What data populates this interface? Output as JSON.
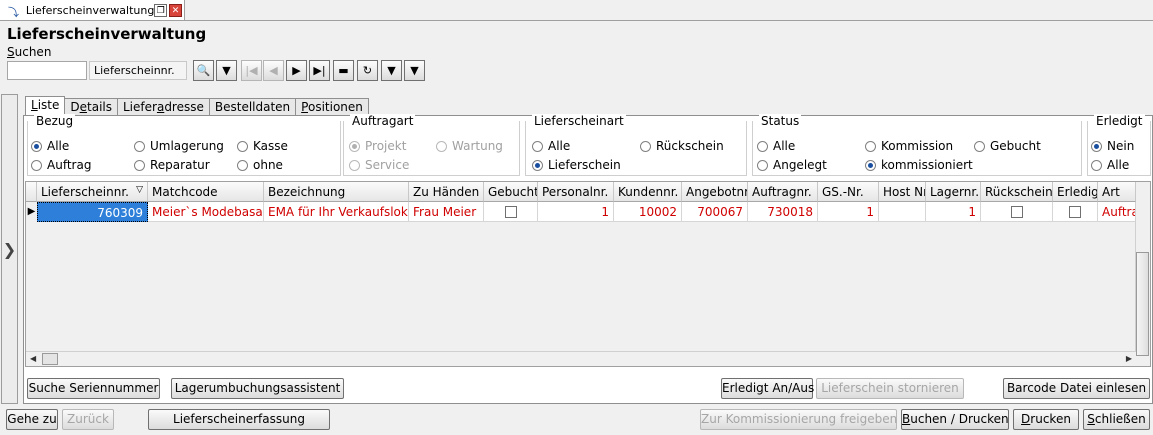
{
  "window": {
    "tab_title": "Lieferscheinverwaltung",
    "page_title": "Lieferscheinverwaltung"
  },
  "search": {
    "label": "Suchen",
    "value": "",
    "field": "Lieferscheinnr."
  },
  "tabs": [
    "Liste",
    "Details",
    "Lieferadresse",
    "Bestelldaten",
    "Positionen"
  ],
  "filters": {
    "bezug": {
      "title": "Bezug",
      "options": [
        "Alle",
        "Umlagerung",
        "Kasse",
        "Auftrag",
        "Reparatur",
        "ohne"
      ],
      "selected": "Alle"
    },
    "auftragart": {
      "title": "Auftragart",
      "options": [
        "Projekt",
        "Wartung",
        "Service"
      ],
      "selected": "Projekt"
    },
    "lieferscheinart": {
      "title": "Lieferscheinart",
      "options": [
        "Alle",
        "Rückschein",
        "Lieferschein"
      ],
      "selected": "Lieferschein"
    },
    "status": {
      "title": "Status",
      "options": [
        "Alle",
        "Kommission",
        "Gebucht",
        "Angelegt",
        "kommissioniert"
      ],
      "selected": "kommissioniert"
    },
    "erledigt": {
      "title": "Erledigt",
      "options": [
        "Nein",
        "Alle"
      ],
      "selected": "Nein"
    }
  },
  "grid": {
    "columns": [
      "Lieferscheinnr.",
      "Matchcode",
      "Bezeichnung",
      "Zu Händen",
      "Gebucht",
      "Personalnr.",
      "Kundennr.",
      "Angebotnr.",
      "Auftragnr.",
      "GS.-Nr.",
      "Host Nr.",
      "Lagernr.",
      "Rückschein",
      "Erledigt",
      "Art"
    ],
    "rows": [
      {
        "lieferscheinnr": "760309",
        "matchcode": "Meier`s Modebasar",
        "bezeichnung": "EMA für Ihr Verkaufslokal",
        "zu_haenden": "Frau Meier",
        "gebucht": false,
        "personalnr": "1",
        "kundennr": "10002",
        "angebotnr": "700067",
        "auftragnr": "730018",
        "gs_nr": "1",
        "host_nr": "",
        "lagernr": "1",
        "rueckschein": false,
        "erledigt": false,
        "art": "Auftrag"
      }
    ]
  },
  "buttons": {
    "suche_seriennummer": "Suche Seriennummer",
    "lagerumbuchung": "Lagerumbuchungsassistent",
    "erledigt_an_aus": "Erledigt An/Aus",
    "lieferschein_stornieren": "Lieferschein stornieren",
    "barcode": "Barcode Datei einlesen",
    "gehe_zu": "Gehe zu",
    "zurueck": "Zurück",
    "lieferscheinerfassung": "Lieferscheinerfassung",
    "kommissionierung": "Zur Kommissionierung freigeben",
    "buchen_drucken": "Buchen / Drucken",
    "drucken": "Drucken",
    "schliessen": "Schließen"
  }
}
